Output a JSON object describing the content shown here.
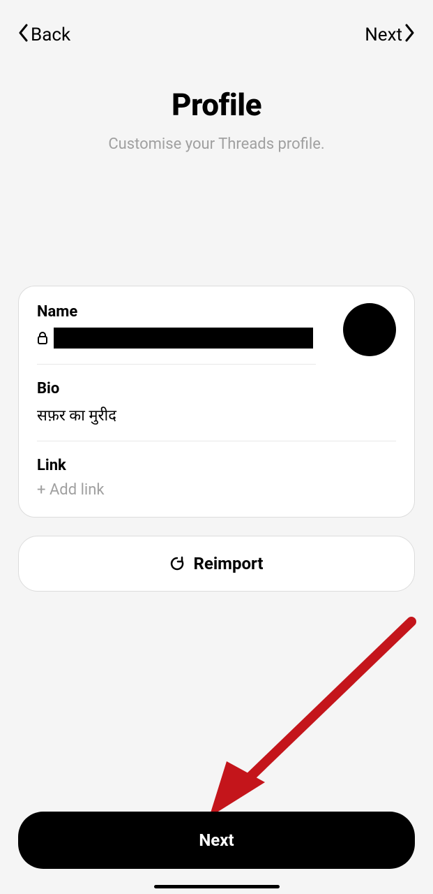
{
  "nav": {
    "back_label": "Back",
    "next_label": "Next"
  },
  "header": {
    "title": "Profile",
    "subtitle": "Customise your Threads profile."
  },
  "fields": {
    "name": {
      "label": "Name"
    },
    "bio": {
      "label": "Bio",
      "value": "सफ़र का मुरीद"
    },
    "link": {
      "label": "Link",
      "placeholder": "+ Add link"
    }
  },
  "reimport": {
    "label": "Reimport"
  },
  "primary": {
    "label": "Next"
  }
}
